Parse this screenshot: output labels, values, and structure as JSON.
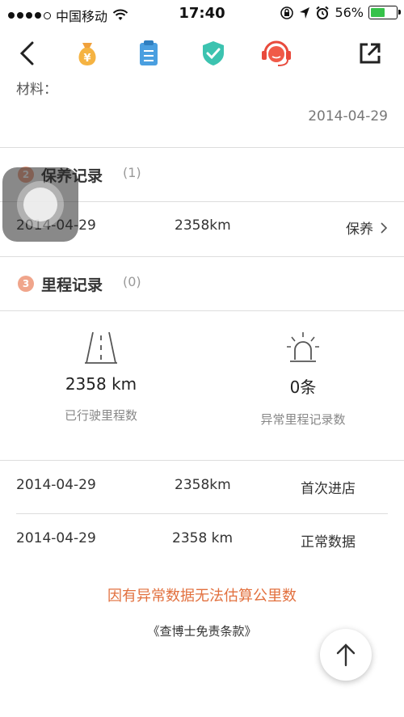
{
  "status_bar": {
    "carrier": "中国移动",
    "time": "17:40",
    "battery_percent": "56%"
  },
  "toolbar": {
    "icons": [
      "back-icon",
      "money-bag-icon",
      "document-icon",
      "shield-check-icon",
      "customer-service-icon",
      "share-icon"
    ]
  },
  "materials_label": "材料：",
  "materials_date": "2014-04-29",
  "maintenance": {
    "number": "2",
    "title": "保养记录",
    "count": "(1)",
    "row": {
      "date": "2014-04-29",
      "mileage": "2358km",
      "type": "保养"
    }
  },
  "mileage": {
    "number": "3",
    "title": "里程记录",
    "count": "(0)",
    "stats": [
      {
        "value": "2358 km",
        "label": "已行驶里程数",
        "icon": "road-icon"
      },
      {
        "value": "0条",
        "label": "异常里程记录数",
        "icon": "alarm-light-icon"
      }
    ],
    "rows": [
      {
        "date": "2014-04-29",
        "mileage": "2358km",
        "status": "首次进店"
      },
      {
        "date": "2014-04-29",
        "mileage": "2358 km",
        "status": "正常数据"
      }
    ]
  },
  "warning_text": "因有异常数据无法估算公里数",
  "terms_text": "《查博士免责条款》",
  "colors": {
    "accent": "#e2703e",
    "badge": "#f0a58b",
    "battery": "#36c24a"
  }
}
